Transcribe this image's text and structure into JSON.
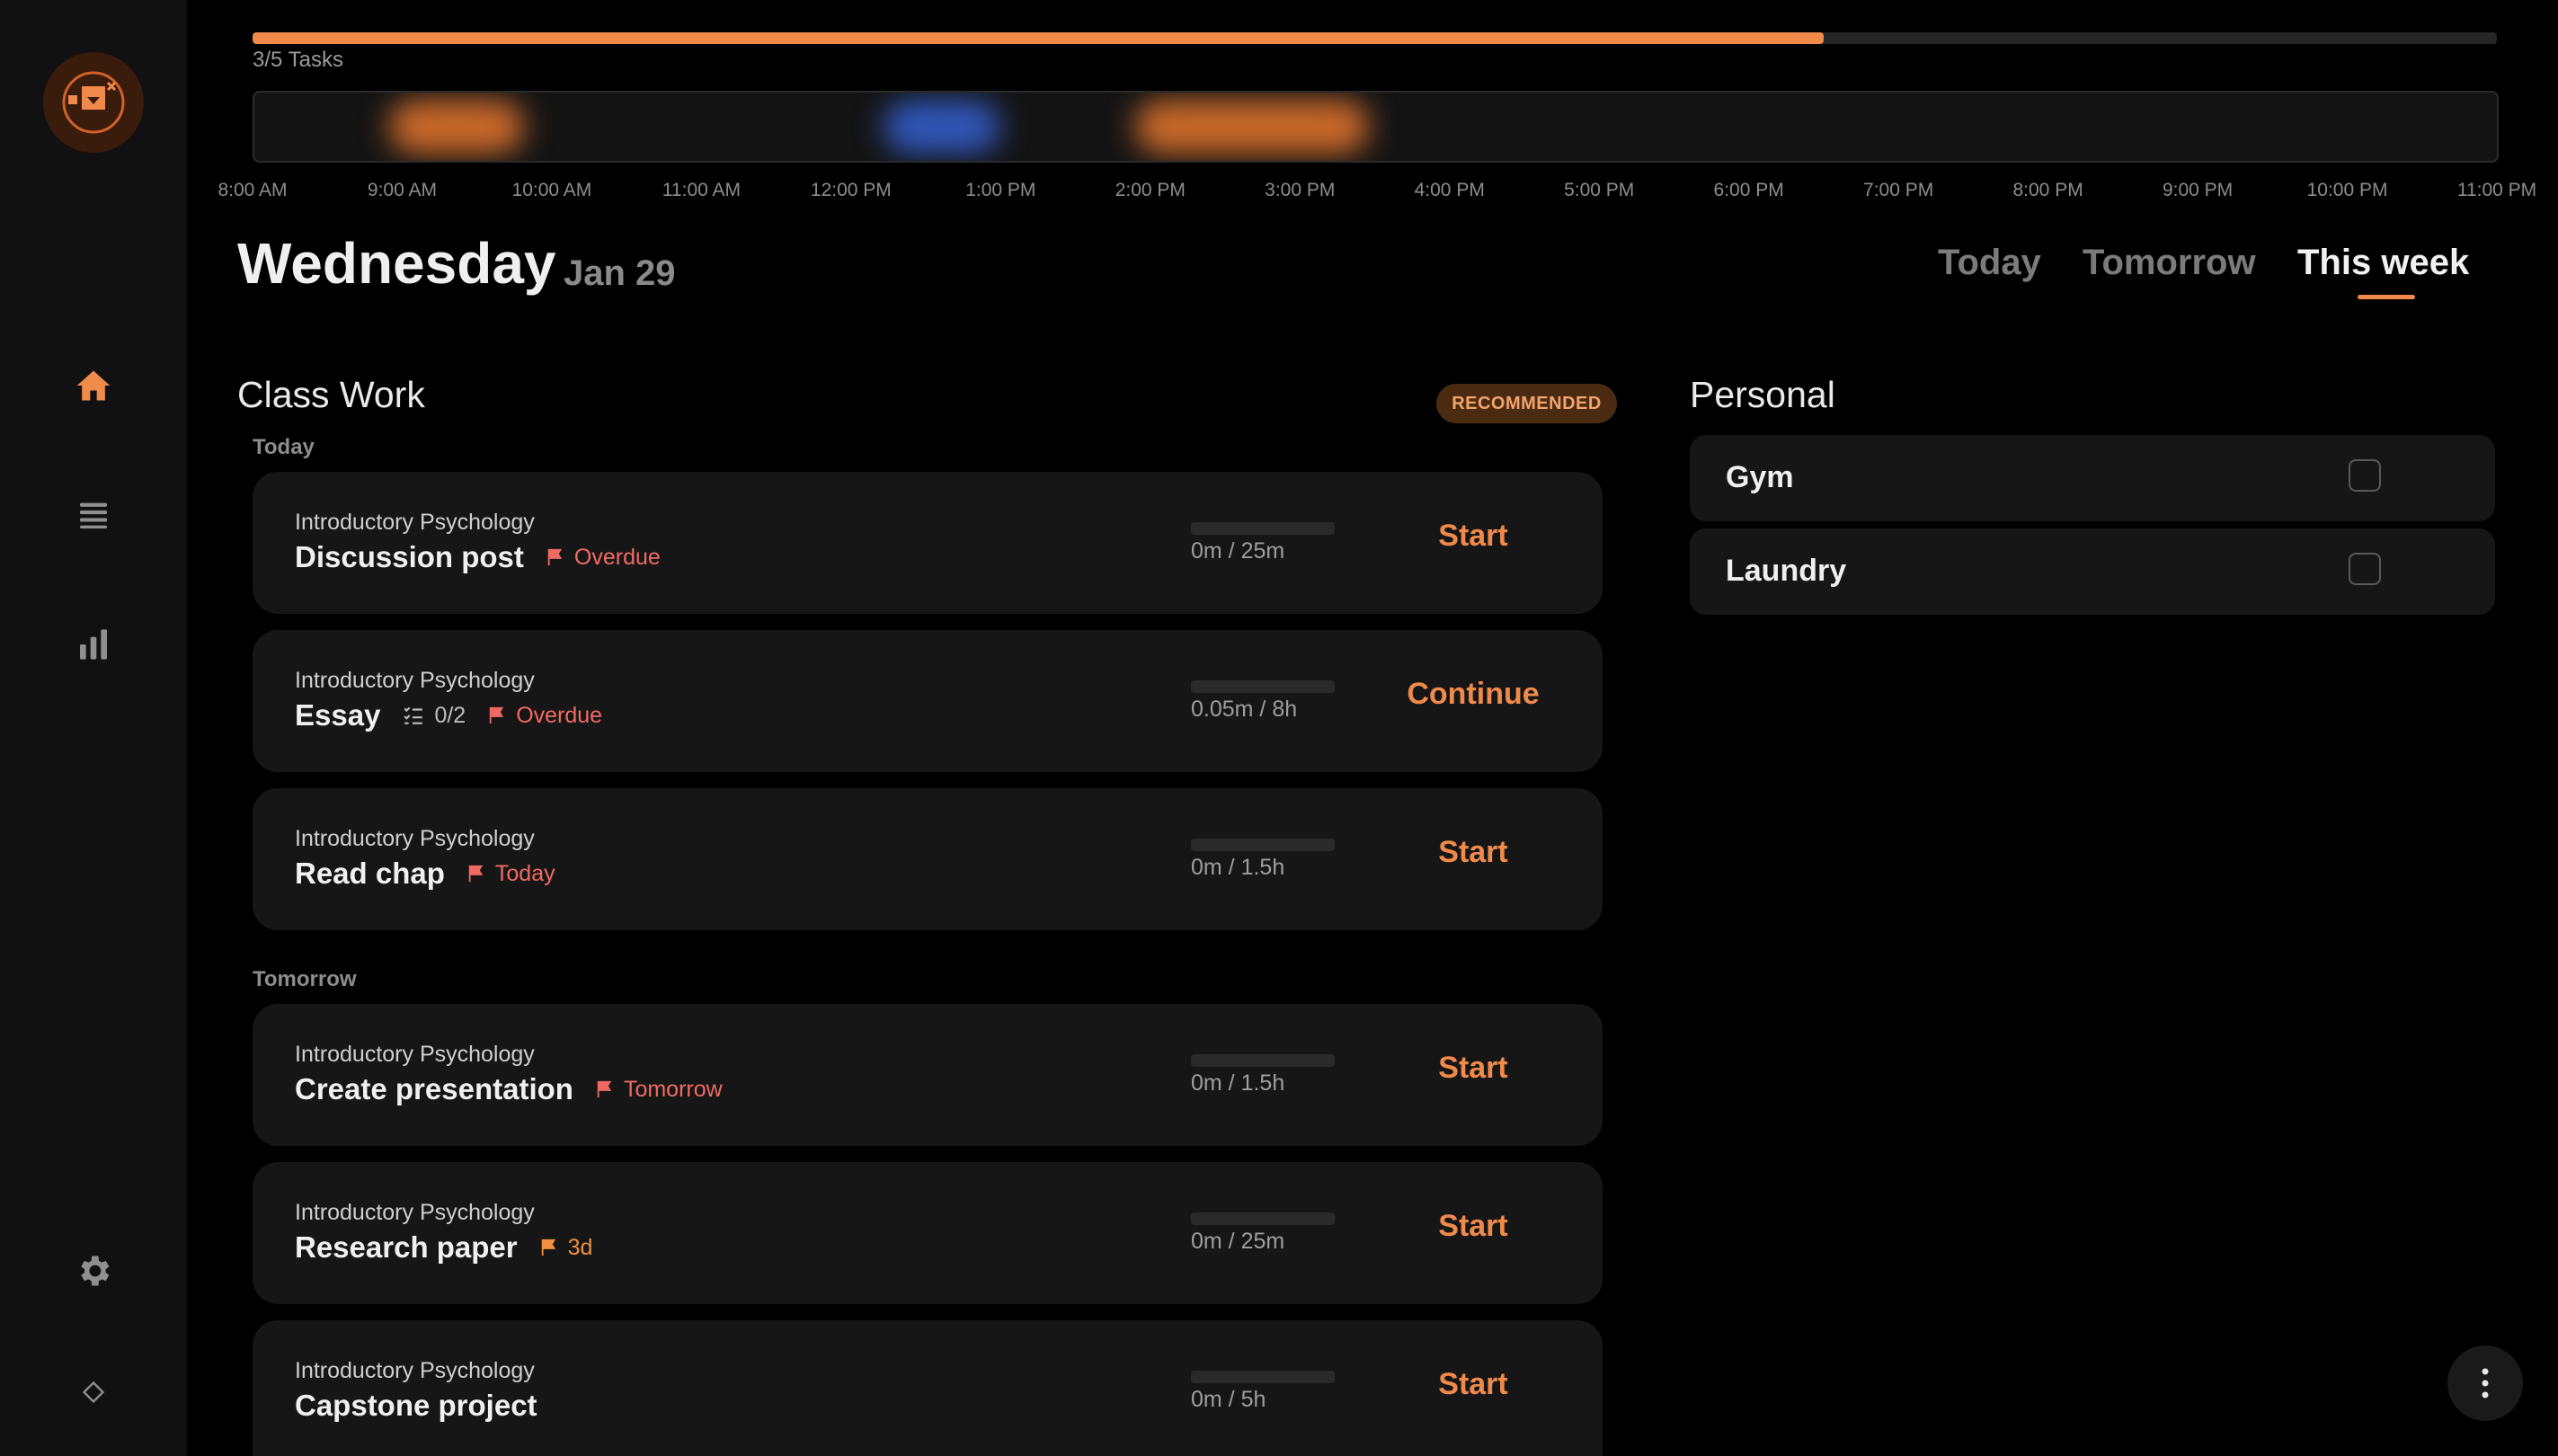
{
  "progress": {
    "label": "3/5 Tasks",
    "fraction": 0.7
  },
  "timeline": {
    "hours": [
      "8:00 AM",
      "9:00 AM",
      "10:00 AM",
      "11:00 AM",
      "12:00 PM",
      "1:00 PM",
      "2:00 PM",
      "3:00 PM",
      "4:00 PM",
      "5:00 PM",
      "6:00 PM",
      "7:00 PM",
      "8:00 PM",
      "9:00 PM",
      "10:00 PM",
      "11:00 PM"
    ],
    "colors": {
      "orange": "#f08a4b",
      "blue": "#3d6de0"
    }
  },
  "header": {
    "day": "Wednesday",
    "date": "Jan 29",
    "tabs": [
      {
        "label": "Today"
      },
      {
        "label": "Tomorrow"
      },
      {
        "label": "This week",
        "active": true
      }
    ]
  },
  "classwork": {
    "title": "Class Work",
    "badge": "RECOMMENDED",
    "groups": [
      {
        "label": "Today"
      },
      {
        "label": "Tomorrow"
      }
    ],
    "tasks": [
      {
        "course": "Introductory Psychology",
        "title": "Discussion post",
        "flag": "Overdue",
        "time": "0m / 25m",
        "action": "Start"
      },
      {
        "course": "Introductory Psychology",
        "title": "Essay",
        "subtasks": "0/2",
        "flag": "Overdue",
        "time": "0.05m / 8h",
        "action": "Continue"
      },
      {
        "course": "Introductory Psychology",
        "title": "Read chap",
        "flag": "Today",
        "time": "0m / 1.5h",
        "action": "Start"
      },
      {
        "course": "Introductory Psychology",
        "title": "Create presentation",
        "flag": "Tomorrow",
        "time": "0m / 1.5h",
        "action": "Start"
      },
      {
        "course": "Introductory Psychology",
        "title": "Research paper",
        "flag": "3d",
        "time": "0m / 25m",
        "action": "Start"
      },
      {
        "course": "Introductory Psychology",
        "title": "Capstone project",
        "time": "0m / 5h",
        "action": "Start"
      }
    ]
  },
  "personal": {
    "title": "Personal",
    "items": [
      {
        "label": "Gym"
      },
      {
        "label": "Laundry"
      }
    ]
  },
  "icons": {
    "logo": "inbox-logo-icon",
    "nav": [
      "home-icon",
      "list-icon",
      "bar-chart-icon"
    ],
    "settings": "gear-icon",
    "extra": "diamond-icon",
    "fab": "more-vertical-icon",
    "flag": "flag-icon",
    "subtasks": "checklist-icon"
  },
  "colors": {
    "accent": "#f08a4b",
    "overdue": "#f06a63",
    "due_soon": "#f09040"
  }
}
